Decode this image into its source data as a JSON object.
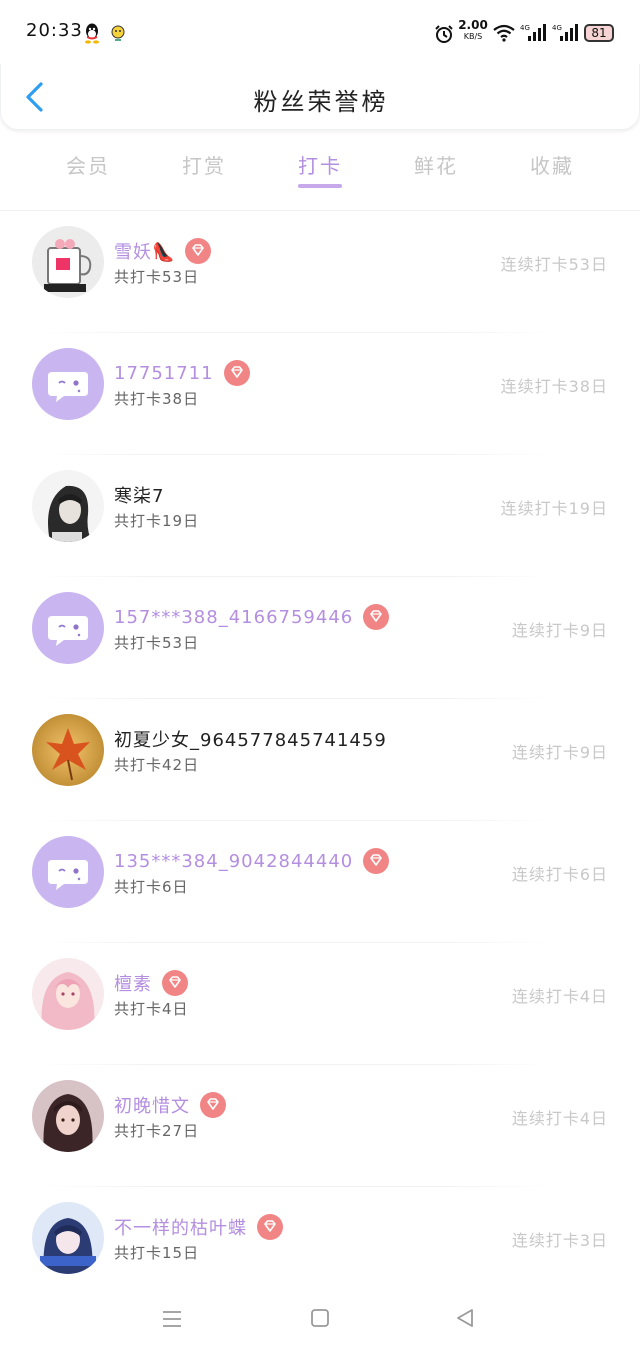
{
  "status_bar": {
    "time": "20:33",
    "net_speed_value": "2.00",
    "net_speed_unit": "KB/S",
    "signal_1": "4G",
    "signal_2": "4G",
    "battery": "81",
    "icons": [
      "qq-icon",
      "sun-icon",
      "alarm-icon",
      "wifi-icon",
      "signal-icon",
      "battery-icon"
    ]
  },
  "header": {
    "title": "粉丝荣誉榜",
    "back_icon": "chevron-left-icon"
  },
  "tabs": [
    {
      "label": "会员",
      "active": false
    },
    {
      "label": "打赏",
      "active": false
    },
    {
      "label": "打卡",
      "active": true
    },
    {
      "label": "鲜花",
      "active": false
    },
    {
      "label": "收藏",
      "active": false
    }
  ],
  "colors": {
    "accent": "#b48fe0",
    "badge": "#f18585",
    "muted": "#c8c8c8"
  },
  "rows": [
    {
      "name": "雪妖👠",
      "vip": true,
      "total": "共打卡53日",
      "streak": "连续打卡53日",
      "avatar": "mug-photo"
    },
    {
      "name": "17751711",
      "vip": true,
      "total": "共打卡38日",
      "streak": "连续打卡38日",
      "avatar": "default-chat"
    },
    {
      "name": "寒柒7",
      "vip": false,
      "total": "共打卡19日",
      "streak": "连续打卡19日",
      "avatar": "girl-bw-photo"
    },
    {
      "name": "157***388_4166759446",
      "vip": true,
      "total": "共打卡53日",
      "streak": "连续打卡9日",
      "avatar": "default-chat"
    },
    {
      "name": "初夏少女_964577845741459",
      "vip": false,
      "total": "共打卡42日",
      "streak": "连续打卡9日",
      "avatar": "autumn-leaf-photo"
    },
    {
      "name": "135***384_9042844440",
      "vip": true,
      "total": "共打卡6日",
      "streak": "连续打卡6日",
      "avatar": "default-chat"
    },
    {
      "name": "檀素",
      "vip": true,
      "total": "共打卡4日",
      "streak": "连续打卡4日",
      "avatar": "anime-pink-photo"
    },
    {
      "name": "初晚惜文",
      "vip": true,
      "total": "共打卡27日",
      "streak": "连续打卡4日",
      "avatar": "girl-dark-photo"
    },
    {
      "name": "不一样的枯叶蝶",
      "vip": true,
      "total": "共打卡15日",
      "streak": "连续打卡3日",
      "avatar": "girl-blue-photo"
    }
  ],
  "nav": {
    "icons": [
      "menu-icon",
      "home-square-icon",
      "back-triangle-icon"
    ]
  }
}
